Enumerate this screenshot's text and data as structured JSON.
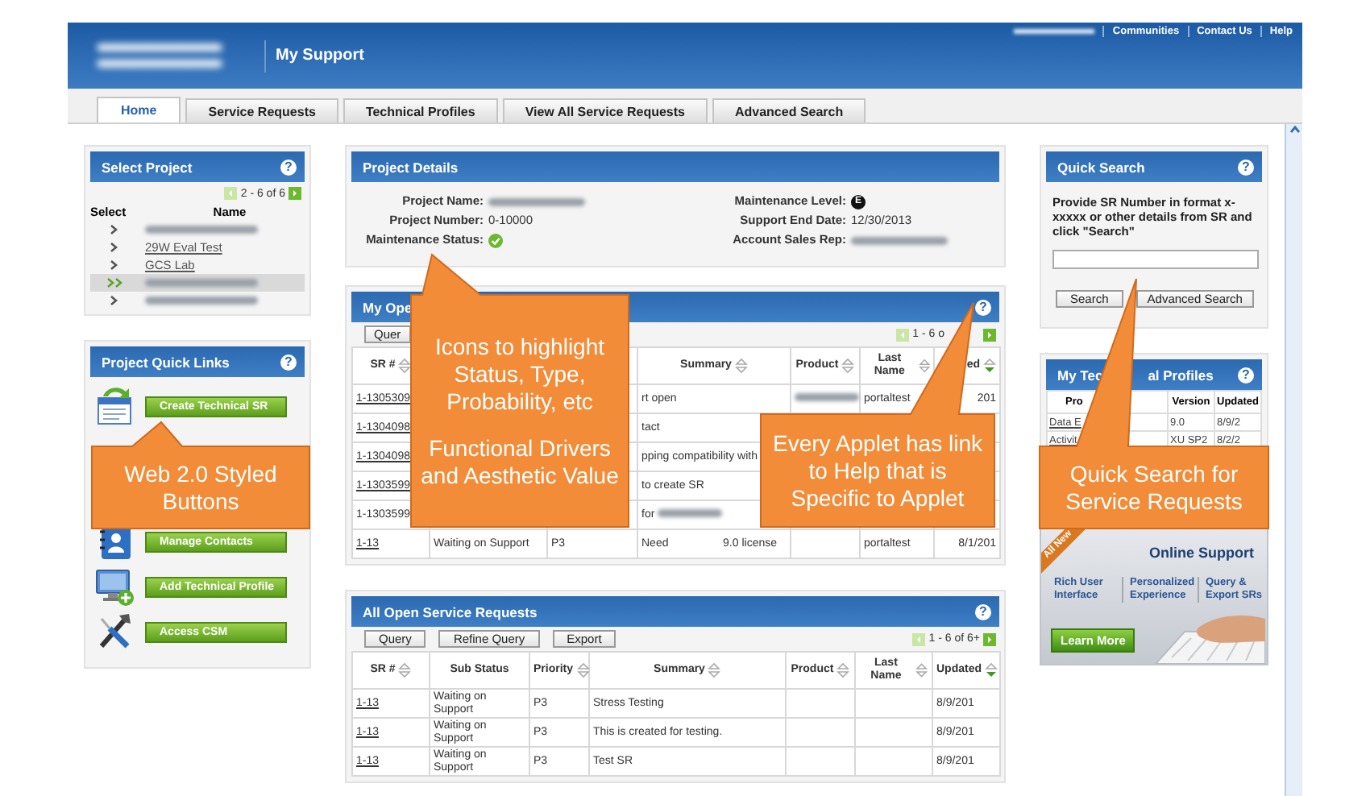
{
  "header": {
    "title": "My Support",
    "links": [
      "Communities",
      "Contact Us",
      "Help"
    ]
  },
  "tabs": [
    {
      "label": "Home",
      "selected": true
    },
    {
      "label": "Service Requests",
      "selected": false
    },
    {
      "label": "Technical Profiles",
      "selected": false
    },
    {
      "label": "View All Service Requests",
      "selected": false
    },
    {
      "label": "Advanced Search",
      "selected": false
    }
  ],
  "select_project": {
    "title": "Select Project",
    "help": "?",
    "pager": "2 - 6 of 6",
    "columns": [
      "Select",
      "Name"
    ],
    "rows": [
      {
        "redacted": true,
        "selected": false
      },
      {
        "name": "29W Eval Test",
        "selected": false
      },
      {
        "name": "GCS Lab",
        "selected": false
      },
      {
        "redacted": true,
        "selected": true
      },
      {
        "redacted": true,
        "selected": false
      }
    ]
  },
  "quick_links": {
    "title": "Project Quick Links",
    "help": "?",
    "items": [
      {
        "label": "Create Technical SR",
        "kind": "document"
      },
      {
        "kind": "covered"
      },
      {
        "kind": "covered"
      },
      {
        "label": "Manage Contacts",
        "kind": "contacts"
      },
      {
        "label": "Add Technical Profile",
        "kind": "monitor"
      },
      {
        "label": "Access CSM",
        "kind": "tools"
      }
    ]
  },
  "project_details": {
    "title": "Project Details",
    "left": [
      {
        "label": "Project Name:",
        "kind": "redacted"
      },
      {
        "label": "Project Number:",
        "kind": "text",
        "value": "0-10000"
      },
      {
        "label": "Maintenance Status:",
        "kind": "check"
      }
    ],
    "right": [
      {
        "label": "Maintenance Level:",
        "kind": "badge",
        "value": "E"
      },
      {
        "label": "Support End Date:",
        "kind": "text",
        "value": "12/30/2013"
      },
      {
        "label": "Account Sales Rep:",
        "kind": "redacted"
      }
    ]
  },
  "my_open": {
    "title": "My Ope",
    "help": "?",
    "buttons": [
      "Quer"
    ],
    "pager": "1 - 6 o",
    "columns": [
      {
        "label": "SR #",
        "sortable": true,
        "sorted": false
      },
      null,
      null,
      {
        "label": "Summary",
        "sortable": true,
        "sorted": false
      },
      {
        "label": "Product",
        "sortable": true,
        "sorted": false
      },
      {
        "label": "Last Name",
        "sortable": true,
        "sorted": false
      },
      {
        "label": "ed",
        "sortable": true,
        "sorted": true
      }
    ],
    "rows": [
      [
        {
          "text": "1-1305309",
          "link": true
        },
        null,
        null,
        {
          "text": "rt open"
        },
        {
          "redacted": true
        },
        {
          "text": "portaltest"
        },
        {
          "text": "201"
        }
      ],
      [
        {
          "text": "1-1304098",
          "link": true
        },
        null,
        null,
        {
          "text": "tact"
        },
        null,
        null,
        null
      ],
      [
        {
          "text": "1-1304098",
          "link": true
        },
        null,
        null,
        {
          "text": "pping compatibility with"
        },
        null,
        null,
        null
      ],
      [
        {
          "text": "1-1303599",
          "link": true
        },
        null,
        null,
        {
          "text": "to create SR"
        },
        null,
        null,
        null
      ],
      [
        {
          "text": "1-1303599",
          "link": false
        },
        null,
        null,
        {
          "text": "for",
          "redacted": true
        },
        null,
        null,
        null
      ],
      [
        {
          "text": "1-13",
          "link": true
        },
        {
          "text": "Waiting on Support"
        },
        {
          "text": "P3"
        },
        {
          "parts": [
            "Need",
            "9.0 license"
          ]
        },
        null,
        {
          "text": "portaltest"
        },
        {
          "text": "8/1/201"
        }
      ]
    ]
  },
  "all_open": {
    "title": "All Open Service Requests",
    "help": "?",
    "buttons": [
      "Query",
      "Refine Query",
      "Export"
    ],
    "pager": "1 - 6 of 6+",
    "columns": [
      {
        "label": "SR #",
        "sortable": true,
        "sorted": false
      },
      {
        "label": "Sub Status",
        "sortable": false
      },
      {
        "label": "Priority",
        "sortable": true,
        "sorted": false
      },
      {
        "label": "Summary",
        "sortable": true,
        "sorted": false
      },
      {
        "label": "Product",
        "sortable": true,
        "sorted": false
      },
      {
        "label": "Last Name",
        "sortable": true,
        "sorted": false
      },
      {
        "label": "Updated",
        "sortable": true,
        "sorted": true
      }
    ],
    "rows": [
      [
        {
          "text": "1-13",
          "link": true
        },
        {
          "text": "Waiting on Support"
        },
        {
          "text": "P3"
        },
        {
          "text": "Stress Testing"
        },
        null,
        null,
        {
          "text": "8/9/201"
        }
      ],
      [
        {
          "text": "1-13",
          "link": true
        },
        {
          "text": "Waiting on Support"
        },
        {
          "text": "P3"
        },
        {
          "text": "This is created for testing."
        },
        null,
        null,
        {
          "text": "8/9/201"
        }
      ],
      [
        {
          "text": "1-13",
          "link": true
        },
        {
          "text": "Waiting on Support"
        },
        {
          "text": "P3"
        },
        {
          "text": "Test SR"
        },
        null,
        null,
        {
          "text": "8/9/201"
        }
      ]
    ]
  },
  "quick_search": {
    "title": "Quick Search",
    "help": "?",
    "instructions": "Provide SR Number in format x-xxxxx or other details from SR and click \"Search\"",
    "buttons": [
      "Search",
      "Advanced Search"
    ]
  },
  "tech_profiles": {
    "title": [
      "My Tec",
      "al Profiles"
    ],
    "help": "?",
    "columns": [
      "Pro",
      "Version",
      "Updated"
    ],
    "rows": [
      [
        "Data E",
        "9.0",
        "8/9/2"
      ],
      [
        "Activit",
        "XU SP2",
        "8/2/2"
      ]
    ]
  },
  "promo": {
    "ribbon": "All New",
    "title": "Online Support",
    "features": [
      "Rich User Interface",
      "Personalized Experience",
      "Query & Export SRs"
    ],
    "button": "Learn More"
  },
  "callouts": [
    {
      "paragraphs": [
        "Web 2.0 Styled Buttons"
      ]
    },
    {
      "paragraphs": [
        "Icons to highlight Status, Type, Probability, etc",
        "Functional Drivers and Aesthetic Value"
      ]
    },
    {
      "paragraphs": [
        "Every Applet has link to Help that is Specific to Applet"
      ]
    },
    {
      "paragraphs": [
        "Quick Search for Service Requests"
      ]
    }
  ]
}
